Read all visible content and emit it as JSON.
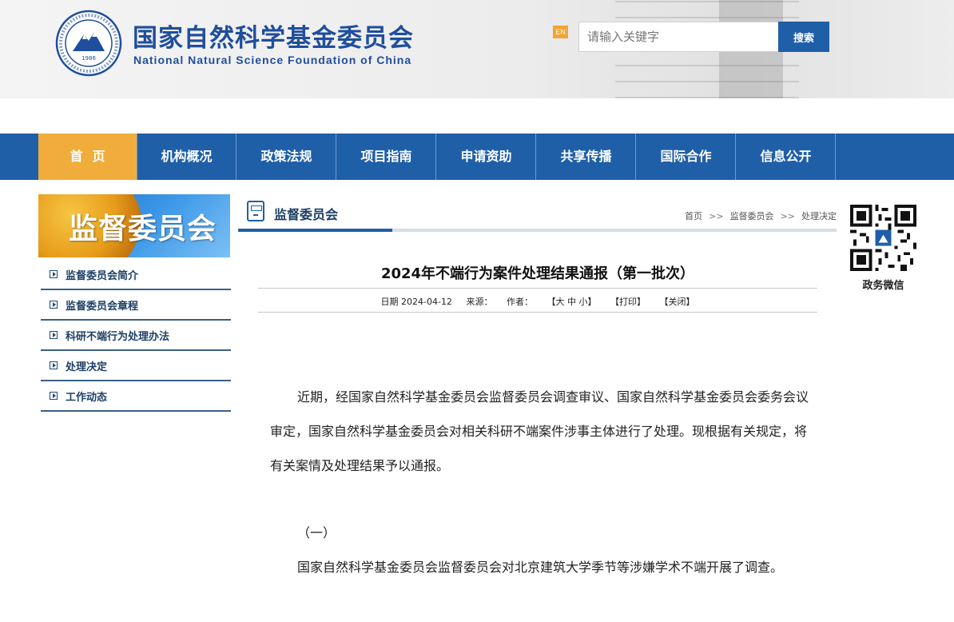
{
  "header": {
    "title_cn": "国家自然科学基金委员会",
    "title_en": "National Natural Science Foundation of China",
    "seal_year": "1986",
    "en_badge": "EN",
    "search_placeholder": "请输入关键字",
    "search_button": "搜索"
  },
  "nav": [
    "首页",
    "机构概况",
    "政策法规",
    "项目指南",
    "申请资助",
    "共享传播",
    "国际合作",
    "信息公开"
  ],
  "sidebar": {
    "banner_title": "监督委员会",
    "items": [
      "监督委员会简介",
      "监督委员会章程",
      "科研不端行为处理办法",
      "处理决定",
      "工作动态"
    ]
  },
  "section": {
    "title": "监督委员会",
    "breadcrumbs": [
      "首页",
      "监督委员会",
      "处理决定"
    ]
  },
  "article": {
    "title": "2024年不端行为案件处理结果通报（第一批次）",
    "meta": {
      "date": "日期 2024-04-12",
      "source": "来源：",
      "author": "作者：",
      "font_size": "【大 中 小】",
      "print": "【打印】",
      "close": "【关闭】"
    },
    "para1": "近期，经国家自然科学基金委员会监督委员会调查审议、国家自然科学基金委员会委务会议审定，国家自然科学基金委员会对相关科研不端案件涉事主体进行了处理。现根据有关规定，将有关案情及处理结果予以通报。",
    "heading1": "（一）",
    "para2": "国家自然科学基金委员会监督委员会对北京建筑大学季节等涉嫌学术不端开展了调查。"
  },
  "qr_label": "政务微信",
  "colors": {
    "nav_blue": "#1f5fa8",
    "nav_active": "#f0ad3b",
    "title_blue": "#1f4e9c"
  }
}
